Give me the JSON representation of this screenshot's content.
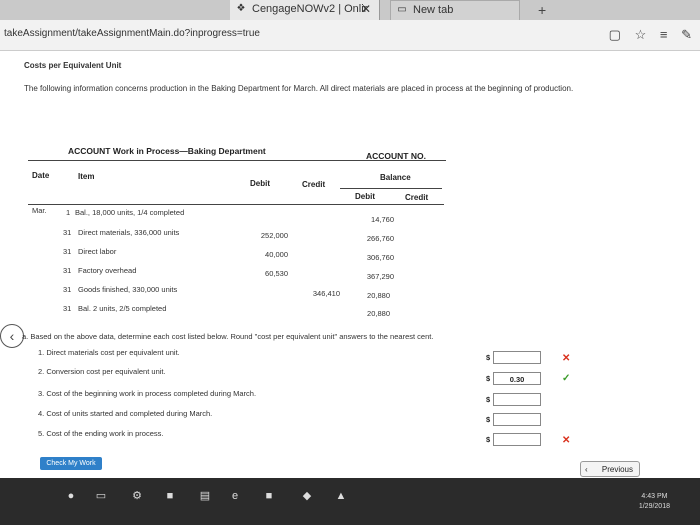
{
  "browser": {
    "active_tab_title": "CengageNOWv2 | Onlir",
    "new_tab_title": "New tab",
    "url": "takeAssignment/takeAssignmentMain.do?inprogress=true"
  },
  "page": {
    "title": "Costs per Equivalent Unit",
    "intro_text": "The following information concerns production in the Baking Department for March. All direct materials are placed in process at the beginning of production."
  },
  "account": {
    "title": "ACCOUNT Work in Process—Baking Department",
    "account_no_label": "ACCOUNT NO.",
    "headers": {
      "date": "Date",
      "item": "Item",
      "debit": "Debit",
      "credit": "Credit",
      "balance": "Balance",
      "bal_debit": "Debit",
      "bal_credit": "Credit"
    },
    "rows": [
      {
        "date": "Mar.",
        "day": "1",
        "item": "Bal., 18,000 units, 1/4 completed",
        "debit": "",
        "credit": "",
        "balance": "14,760"
      },
      {
        "date": "",
        "day": "31",
        "item": "Direct materials, 336,000 units",
        "debit": "252,000",
        "credit": "",
        "balance": "266,760"
      },
      {
        "date": "",
        "day": "31",
        "item": "Direct labor",
        "debit": "40,000",
        "credit": "",
        "balance": "306,760"
      },
      {
        "date": "",
        "day": "31",
        "item": "Factory overhead",
        "debit": "60,530",
        "credit": "",
        "balance": "367,290"
      },
      {
        "date": "",
        "day": "31",
        "item": "Goods finished, 330,000 units",
        "debit": "",
        "credit": "346,410",
        "balance": "20,880"
      },
      {
        "date": "",
        "day": "31",
        "item": "Bal. 2 units, 2/5 completed",
        "debit": "",
        "credit": "",
        "balance": "20,880"
      }
    ]
  },
  "questions": {
    "prompt": "a.  Based on the above data, determine each cost listed below. Round \"cost per equivalent unit\" answers to the nearest cent.",
    "items": [
      {
        "label": "1.  Direct materials cost per equivalent unit.",
        "currency": "$",
        "value": ""
      },
      {
        "label": "2.  Conversion cost per equivalent unit.",
        "currency": "$",
        "value": "0.30"
      },
      {
        "label": "3.  Cost of the beginning work in process completed during March.",
        "currency": "$",
        "value": ""
      },
      {
        "label": "4.  Cost of units started and completed during March.",
        "currency": "$",
        "value": ""
      },
      {
        "label": "5.  Cost of the ending work in process.",
        "currency": "$",
        "value": ""
      }
    ]
  },
  "buttons": {
    "check_my_work": "Check My Work",
    "previous": "Previous"
  },
  "taskbar": {
    "time": "4:43 PM",
    "date": "1/29/2018"
  },
  "colors": {
    "incorrect": "#d9301c",
    "correct": "#3a9b28",
    "accent": "#2f80c9"
  }
}
